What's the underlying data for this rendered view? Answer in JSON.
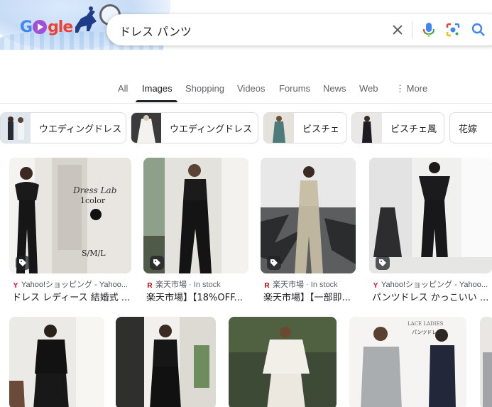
{
  "search": {
    "query": "ドレス パンツ",
    "logo_text_1": "G",
    "logo_text_2": "gle"
  },
  "tabs": [
    {
      "label": "All",
      "active": false
    },
    {
      "label": "Images",
      "active": true
    },
    {
      "label": "Shopping",
      "active": false
    },
    {
      "label": "Videos",
      "active": false
    },
    {
      "label": "Forums",
      "active": false
    },
    {
      "label": "News",
      "active": false
    },
    {
      "label": "Web",
      "active": false
    },
    {
      "label": "More",
      "active": false
    }
  ],
  "chips": [
    {
      "label": "ウエディングドレス"
    },
    {
      "label": "ウエディングドレス"
    },
    {
      "label": "ビスチェ"
    },
    {
      "label": "ビスチェ風"
    },
    {
      "label": "花嫁"
    }
  ],
  "results": [
    {
      "source": "Yahoo!ショッピング - Yahoo...",
      "stock": "",
      "title": "ドレス レディース 結婚式 ...",
      "favicon": "Y",
      "overlay_text_1": "Dress Lab",
      "overlay_text_2": "1color",
      "overlay_text_3": "S/M/L"
    },
    {
      "source": "楽天市場",
      "stock": "In stock",
      "title": "楽天市場】【18%OFF...",
      "favicon": "R"
    },
    {
      "source": "楽天市場",
      "stock": "In stock",
      "title": "楽天市場】【一部即...",
      "favicon": "R"
    },
    {
      "source": "Yahoo!ショッピング - Yahoo...",
      "stock": "",
      "title": "パンツドレス かっこいい ...",
      "favicon": "Y"
    }
  ],
  "row2_labels": {
    "brand": "LACE LADIES",
    "product": "パンツドレス"
  },
  "colors": {
    "accent_blue": "#4285f4",
    "active_tab": "#202124",
    "text_secondary": "#5f6368"
  }
}
